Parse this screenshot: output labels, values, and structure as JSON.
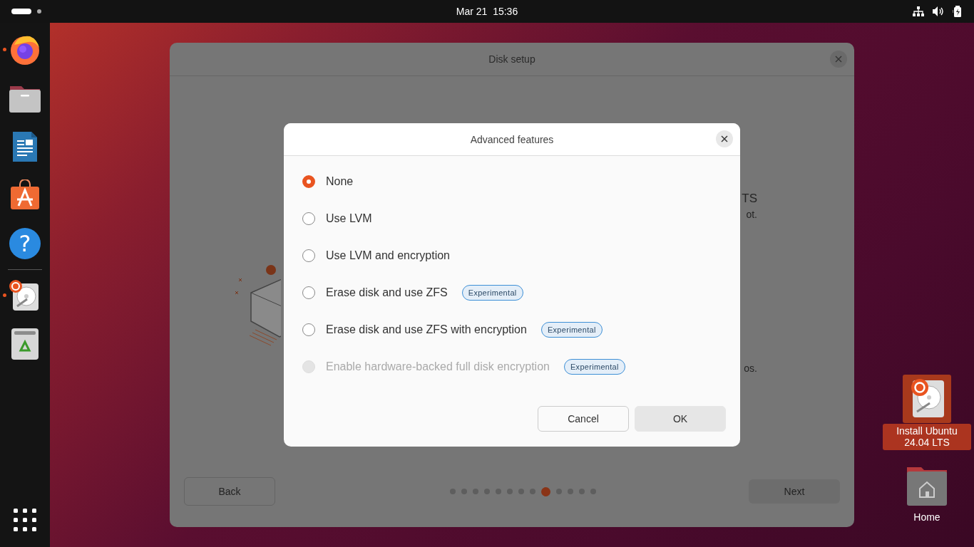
{
  "top_bar": {
    "clock": "Mar 21  15:36"
  },
  "dock": {
    "items": [
      {
        "kind": "browser",
        "running": true
      },
      {
        "kind": "files",
        "running": false
      },
      {
        "kind": "writer",
        "running": false
      },
      {
        "kind": "store",
        "running": false
      },
      {
        "kind": "help",
        "running": false,
        "glyph": "?"
      },
      {
        "kind": "separator"
      },
      {
        "kind": "installer",
        "running": true
      },
      {
        "kind": "trash",
        "running": false
      }
    ]
  },
  "window": {
    "title": "Disk setup",
    "background_texts": [
      {
        "text": "TS",
        "kind": "heading"
      },
      {
        "text": "ot.",
        "kind": "line"
      },
      {
        "text": "os.",
        "kind": "note"
      }
    ],
    "back_button": "Back",
    "next_button": "Next",
    "pager": [
      {
        "selected": false
      },
      {
        "selected": false
      },
      {
        "selected": false
      },
      {
        "selected": false
      },
      {
        "selected": false
      },
      {
        "selected": false
      },
      {
        "selected": false
      },
      {
        "selected": false
      },
      {
        "selected": true
      },
      {
        "selected": false
      },
      {
        "selected": false
      },
      {
        "selected": false
      },
      {
        "selected": false
      }
    ]
  },
  "dialog": {
    "title": "Advanced features",
    "options": [
      {
        "label": "None",
        "selected": true,
        "disabled": false
      },
      {
        "label": "Use LVM",
        "selected": false,
        "disabled": false
      },
      {
        "label": "Use LVM and encryption",
        "selected": false,
        "disabled": false
      },
      {
        "label": "Erase disk and use ZFS",
        "selected": false,
        "disabled": false,
        "badge": "Experimental"
      },
      {
        "label": "Erase disk and use ZFS with encryption",
        "selected": false,
        "disabled": false,
        "badge": "Experimental"
      },
      {
        "label": "Enable hardware-backed full disk encryption",
        "selected": false,
        "disabled": true,
        "badge": "Experimental"
      }
    ],
    "buttons": [
      {
        "label": "Cancel",
        "kind": "secondary"
      },
      {
        "label": "OK",
        "kind": "default"
      }
    ]
  },
  "desktop_icons": [
    {
      "label": "Install Ubuntu 24.04 LTS",
      "kind": "installer",
      "selected": true
    },
    {
      "label": "Home",
      "kind": "home",
      "selected": false
    }
  ]
}
